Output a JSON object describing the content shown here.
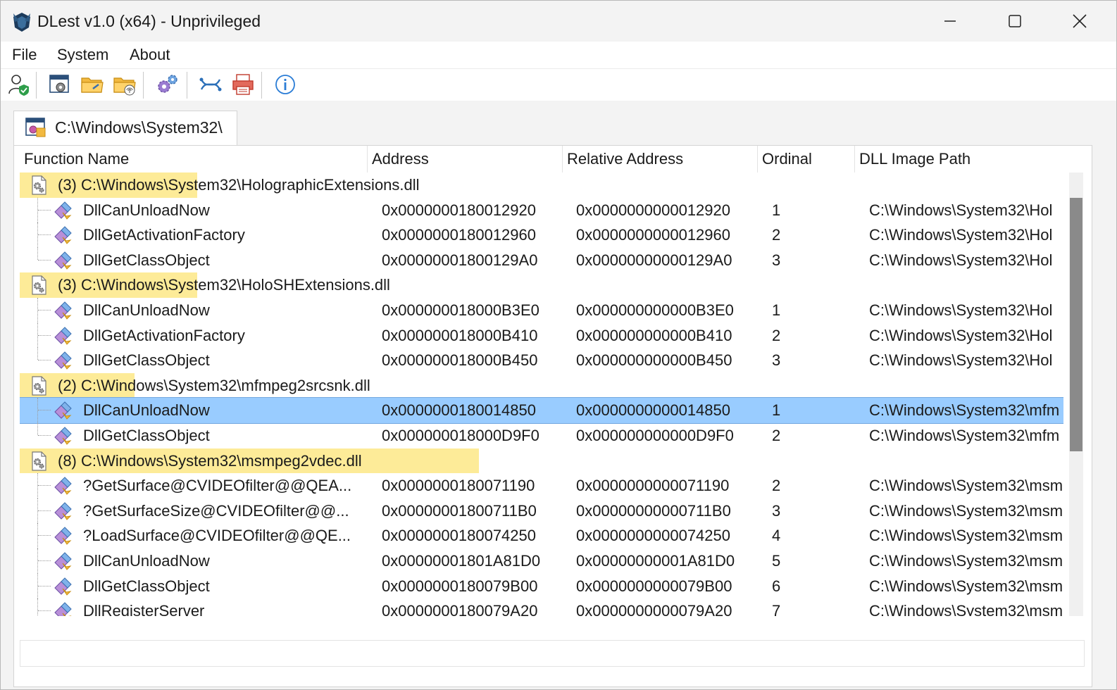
{
  "window": {
    "title": "DLest v1.0 (x64) - Unprivileged",
    "controls": {
      "minimize": "minimize",
      "maximize": "maximize",
      "close": "close"
    }
  },
  "menu": {
    "items": [
      {
        "label": "File"
      },
      {
        "label": "System"
      },
      {
        "label": "About"
      }
    ]
  },
  "toolbar": {
    "buttons": [
      {
        "icon": "user-shield-icon"
      },
      {
        "icon": "process-window-gear-icon"
      },
      {
        "icon": "open-folder-icon"
      },
      {
        "icon": "folder-fingerprint-icon"
      },
      {
        "icon": "gears-icon"
      },
      {
        "icon": "connection-icon"
      },
      {
        "icon": "print-icon"
      },
      {
        "icon": "info-icon"
      }
    ]
  },
  "tab": {
    "label": "C:\\Windows\\System32\\"
  },
  "table": {
    "columns": [
      "Function Name",
      "Address",
      "Relative Address",
      "Ordinal",
      "DLL Image Path"
    ],
    "rows": [
      {
        "type": "group",
        "label": "(3) C:\\Windows\\System32\\HolographicExtensions.dll",
        "highlight_fraction": 0.17
      },
      {
        "type": "fn",
        "name": "DllCanUnloadNow",
        "address": "0x0000000180012920",
        "relative": "0x0000000000012920",
        "ordinal": "1",
        "path": "C:\\Windows\\System32\\Hol"
      },
      {
        "type": "fn",
        "name": "DllGetActivationFactory",
        "address": "0x0000000180012960",
        "relative": "0x0000000000012960",
        "ordinal": "2",
        "path": "C:\\Windows\\System32\\Hol"
      },
      {
        "type": "fn",
        "name": "DllGetClassObject",
        "address": "0x00000001800129A0",
        "relative": "0x00000000000129A0",
        "ordinal": "3",
        "path": "C:\\Windows\\System32\\Hol",
        "last": true
      },
      {
        "type": "group",
        "label": "(3) C:\\Windows\\System32\\HoloSHExtensions.dll",
        "highlight_fraction": 0.17
      },
      {
        "type": "fn",
        "name": "DllCanUnloadNow",
        "address": "0x000000018000B3E0",
        "relative": "0x000000000000B3E0",
        "ordinal": "1",
        "path": "C:\\Windows\\System32\\Hol"
      },
      {
        "type": "fn",
        "name": "DllGetActivationFactory",
        "address": "0x000000018000B410",
        "relative": "0x000000000000B410",
        "ordinal": "2",
        "path": "C:\\Windows\\System32\\Hol"
      },
      {
        "type": "fn",
        "name": "DllGetClassObject",
        "address": "0x000000018000B450",
        "relative": "0x000000000000B450",
        "ordinal": "3",
        "path": "C:\\Windows\\System32\\Hol",
        "last": true
      },
      {
        "type": "group",
        "label": "(2) C:\\Windows\\System32\\mfmpeg2srcsnk.dll",
        "highlight_fraction": 0.11
      },
      {
        "type": "fn",
        "name": "DllCanUnloadNow",
        "address": "0x0000000180014850",
        "relative": "0x0000000000014850",
        "ordinal": "1",
        "path": "C:\\Windows\\System32\\mfm",
        "selected": true
      },
      {
        "type": "fn",
        "name": "DllGetClassObject",
        "address": "0x000000018000D9F0",
        "relative": "0x000000000000D9F0",
        "ordinal": "2",
        "path": "C:\\Windows\\System32\\mfm",
        "last": true
      },
      {
        "type": "group",
        "label": "(8) C:\\Windows\\System32\\msmpeg2vdec.dll",
        "highlight_fraction": 0.44
      },
      {
        "type": "fn",
        "name": "?GetSurface@CVIDEOfilter@@QEA...",
        "address": "0x0000000180071190",
        "relative": "0x0000000000071190",
        "ordinal": "2",
        "path": "C:\\Windows\\System32\\msm"
      },
      {
        "type": "fn",
        "name": "?GetSurfaceSize@CVIDEOfilter@@...",
        "address": "0x00000001800711B0",
        "relative": "0x00000000000711B0",
        "ordinal": "3",
        "path": "C:\\Windows\\System32\\msm"
      },
      {
        "type": "fn",
        "name": "?LoadSurface@CVIDEOfilter@@QE...",
        "address": "0x0000000180074250",
        "relative": "0x0000000000074250",
        "ordinal": "4",
        "path": "C:\\Windows\\System32\\msm"
      },
      {
        "type": "fn",
        "name": "DllCanUnloadNow",
        "address": "0x00000001801A81D0",
        "relative": "0x00000000001A81D0",
        "ordinal": "5",
        "path": "C:\\Windows\\System32\\msm"
      },
      {
        "type": "fn",
        "name": "DllGetClassObject",
        "address": "0x0000000180079B00",
        "relative": "0x0000000000079B00",
        "ordinal": "6",
        "path": "C:\\Windows\\System32\\msm"
      },
      {
        "type": "fn",
        "name": "DllRegisterServer",
        "address": "0x0000000180079A20",
        "relative": "0x0000000000079A20",
        "ordinal": "7",
        "path": "C:\\Windows\\System32\\msm"
      }
    ]
  },
  "colors": {
    "selection": "#99ccff",
    "group_highlight": "#fdeb98",
    "scrollbar_thumb": "#8a8a8a"
  },
  "statusbar": {
    "text": ""
  }
}
